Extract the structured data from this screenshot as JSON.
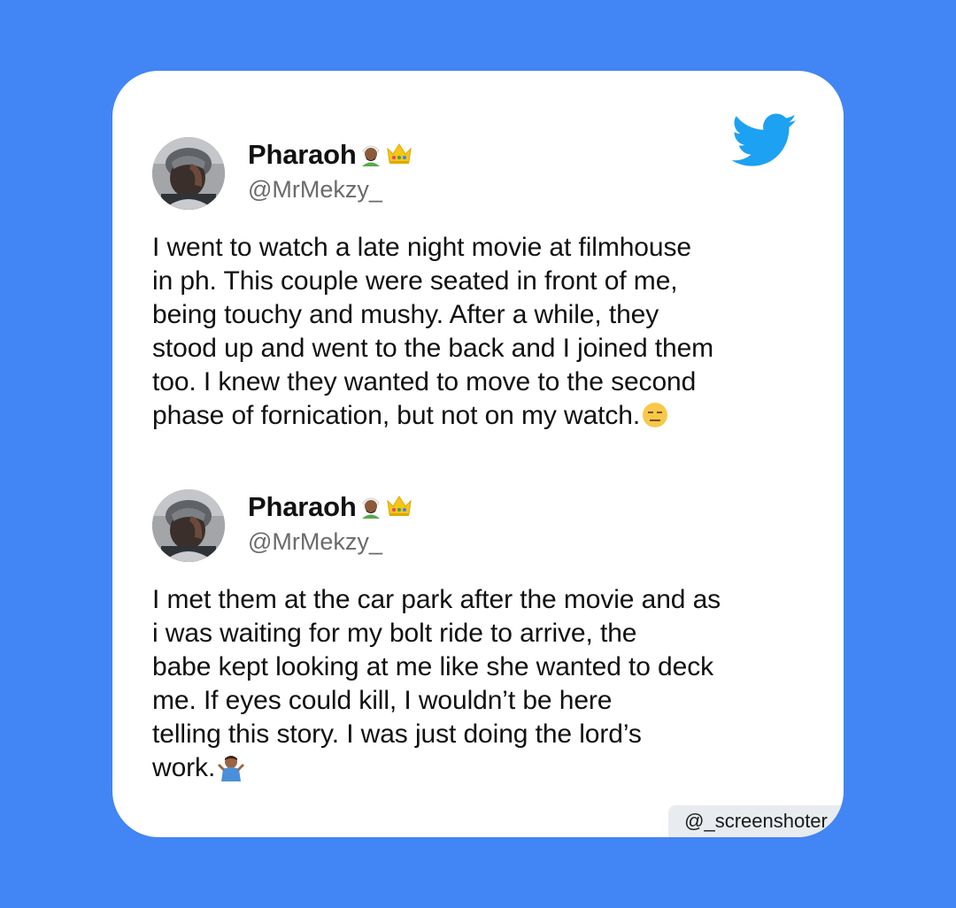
{
  "colors": {
    "background": "#4285f4",
    "card": "#ffffff",
    "twitter_blue": "#1da1f2",
    "text": "#111111",
    "handle": "#6b6b6b"
  },
  "icons": {
    "brand": "twitter-bird-icon",
    "name_emojis": [
      "man-with-turban-emoji",
      "crown-emoji"
    ],
    "tweet1_end": "expressionless-face-emoji",
    "tweet2_end": "person-shrugging-emoji"
  },
  "tweets": [
    {
      "author": "Pharaoh",
      "handle": "@MrMekzy_",
      "text": "I went to watch a late night movie at filmhouse\nin ph. This couple were seated in front of me,\nbeing touchy and mushy. After a while, they\nstood up and went to the back and I joined them\ntoo. I knew they wanted to move to the second\nphase of fornication, but not on my watch."
    },
    {
      "author": "Pharaoh",
      "handle": "@MrMekzy_",
      "text": "I met them at the car park after the movie and as\ni was waiting for my bolt ride to arrive, the\nbabe kept looking at me like she wanted to deck\nme. If eyes could kill, I wouldn’t be here\ntelling this story. I was just doing the lord’s\nwork."
    }
  ],
  "watermark": "@_screenshoter"
}
